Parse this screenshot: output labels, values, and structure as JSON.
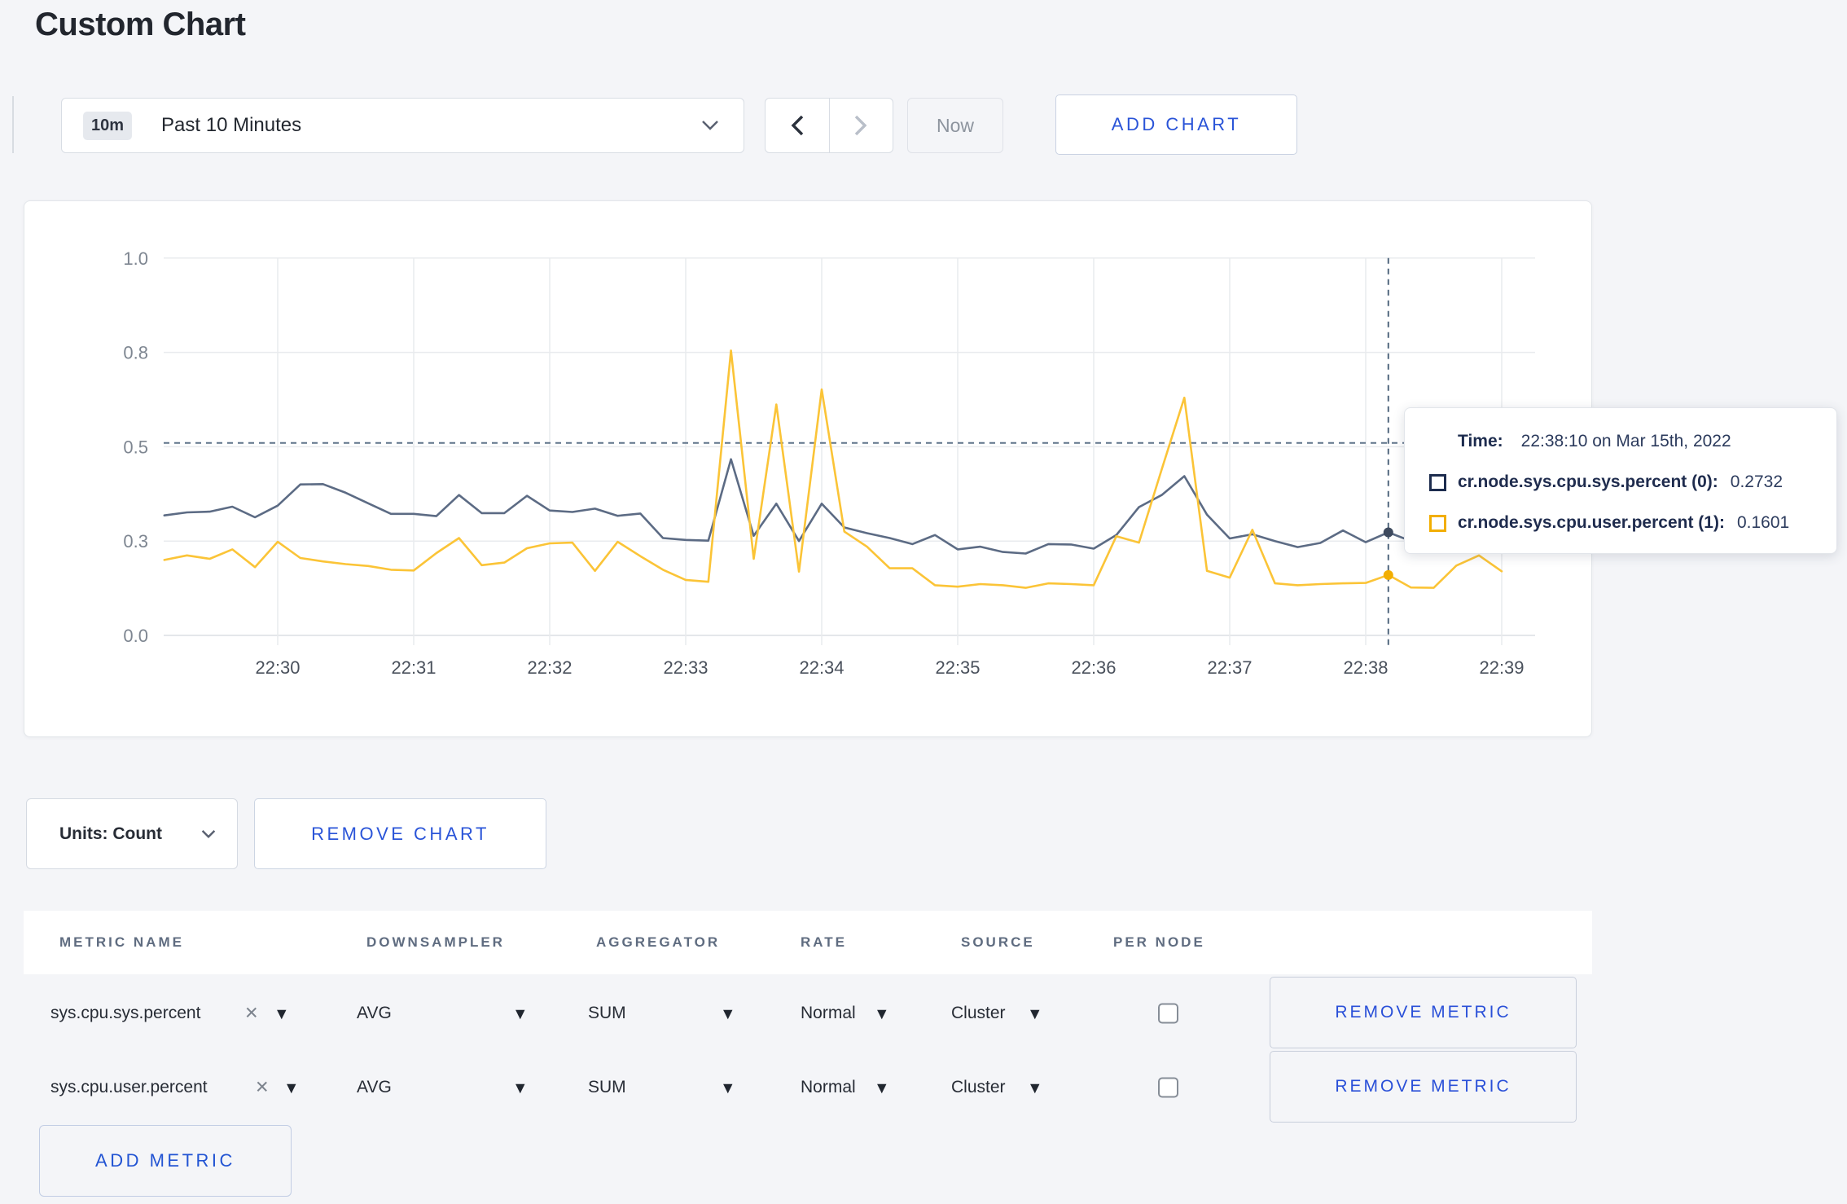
{
  "title": "Custom Chart",
  "toolbar": {
    "range_badge": "10m",
    "range_label": "Past 10 Minutes",
    "now": "Now",
    "add_chart": "ADD CHART"
  },
  "chart_data": {
    "type": "line",
    "title": "",
    "xlabel": "",
    "ylabel": "",
    "x_start": "22:29:10",
    "x_step_seconds": 10,
    "x_tick_labels": [
      "22:30",
      "22:31",
      "22:32",
      "22:33",
      "22:34",
      "22:35",
      "22:36",
      "22:37",
      "22:38",
      "22:39"
    ],
    "y_tick_labels": [
      "0.0",
      "0.3",
      "0.5",
      "0.8",
      "1.0"
    ],
    "y_tick_values": [
      0,
      0.25,
      0.5,
      0.75,
      1.0
    ],
    "ylim": [
      0,
      1.0
    ],
    "grid": true,
    "crosshair": {
      "time": "22:38:10",
      "index": 54,
      "dashed_y_value": 0.51
    },
    "series": [
      {
        "name": "cr.node.sys.cpu.sys.percent (0)",
        "color": "#5c6b84",
        "dot_color": "#3e4a5e",
        "values": [
          0.318,
          0.326,
          0.328,
          0.341,
          0.313,
          0.344,
          0.4,
          0.401,
          0.378,
          0.35,
          0.322,
          0.322,
          0.316,
          0.372,
          0.324,
          0.324,
          0.37,
          0.331,
          0.327,
          0.336,
          0.317,
          0.323,
          0.258,
          0.253,
          0.251,
          0.467,
          0.264,
          0.349,
          0.25,
          0.349,
          0.286,
          0.271,
          0.258,
          0.242,
          0.266,
          0.228,
          0.235,
          0.221,
          0.217,
          0.242,
          0.241,
          0.23,
          0.266,
          0.34,
          0.372,
          0.422,
          0.32,
          0.257,
          0.268,
          0.25,
          0.234,
          0.245,
          0.278,
          0.247,
          0.2732,
          0.25,
          0.255,
          0.26,
          0.252,
          0.258
        ]
      },
      {
        "name": "cr.node.sys.cpu.user.percent (1)",
        "color": "#fbc437",
        "dot_color": "#f2ae00",
        "values": [
          0.2,
          0.212,
          0.203,
          0.228,
          0.181,
          0.248,
          0.205,
          0.196,
          0.189,
          0.184,
          0.174,
          0.172,
          0.218,
          0.258,
          0.186,
          0.193,
          0.231,
          0.244,
          0.246,
          0.171,
          0.248,
          0.21,
          0.174,
          0.147,
          0.142,
          0.755,
          0.203,
          0.612,
          0.169,
          0.652,
          0.275,
          0.235,
          0.178,
          0.178,
          0.133,
          0.129,
          0.136,
          0.133,
          0.126,
          0.138,
          0.136,
          0.133,
          0.263,
          0.246,
          0.44,
          0.63,
          0.171,
          0.153,
          0.28,
          0.138,
          0.133,
          0.136,
          0.138,
          0.139,
          0.1601,
          0.127,
          0.126,
          0.185,
          0.212,
          0.17
        ]
      }
    ]
  },
  "tooltip": {
    "time_label": "Time:",
    "time_value": "22:38:10 on Mar 15th, 2022",
    "rows": [
      {
        "name": "cr.node.sys.cpu.sys.percent (0):",
        "value": "0.2732",
        "color": "#1d2c4e"
      },
      {
        "name": "cr.node.sys.cpu.user.percent (1):",
        "value": "0.1601",
        "color": "#f2ae00"
      }
    ]
  },
  "controls": {
    "units": "Units: Count",
    "remove_chart": "REMOVE CHART"
  },
  "metrics_table": {
    "headers": [
      "METRIC NAME",
      "DOWNSAMPLER",
      "AGGREGATOR",
      "RATE",
      "SOURCE",
      "PER NODE"
    ],
    "rows": [
      {
        "metric": "sys.cpu.sys.percent",
        "downsampler": "AVG",
        "aggregator": "SUM",
        "rate": "Normal",
        "source": "Cluster",
        "per_node": false,
        "remove": "REMOVE METRIC"
      },
      {
        "metric": "sys.cpu.user.percent",
        "downsampler": "AVG",
        "aggregator": "SUM",
        "rate": "Normal",
        "source": "Cluster",
        "per_node": false,
        "remove": "REMOVE METRIC"
      }
    ],
    "add_metric": "ADD METRIC",
    "x_icon": "✕",
    "caret": "▾"
  }
}
